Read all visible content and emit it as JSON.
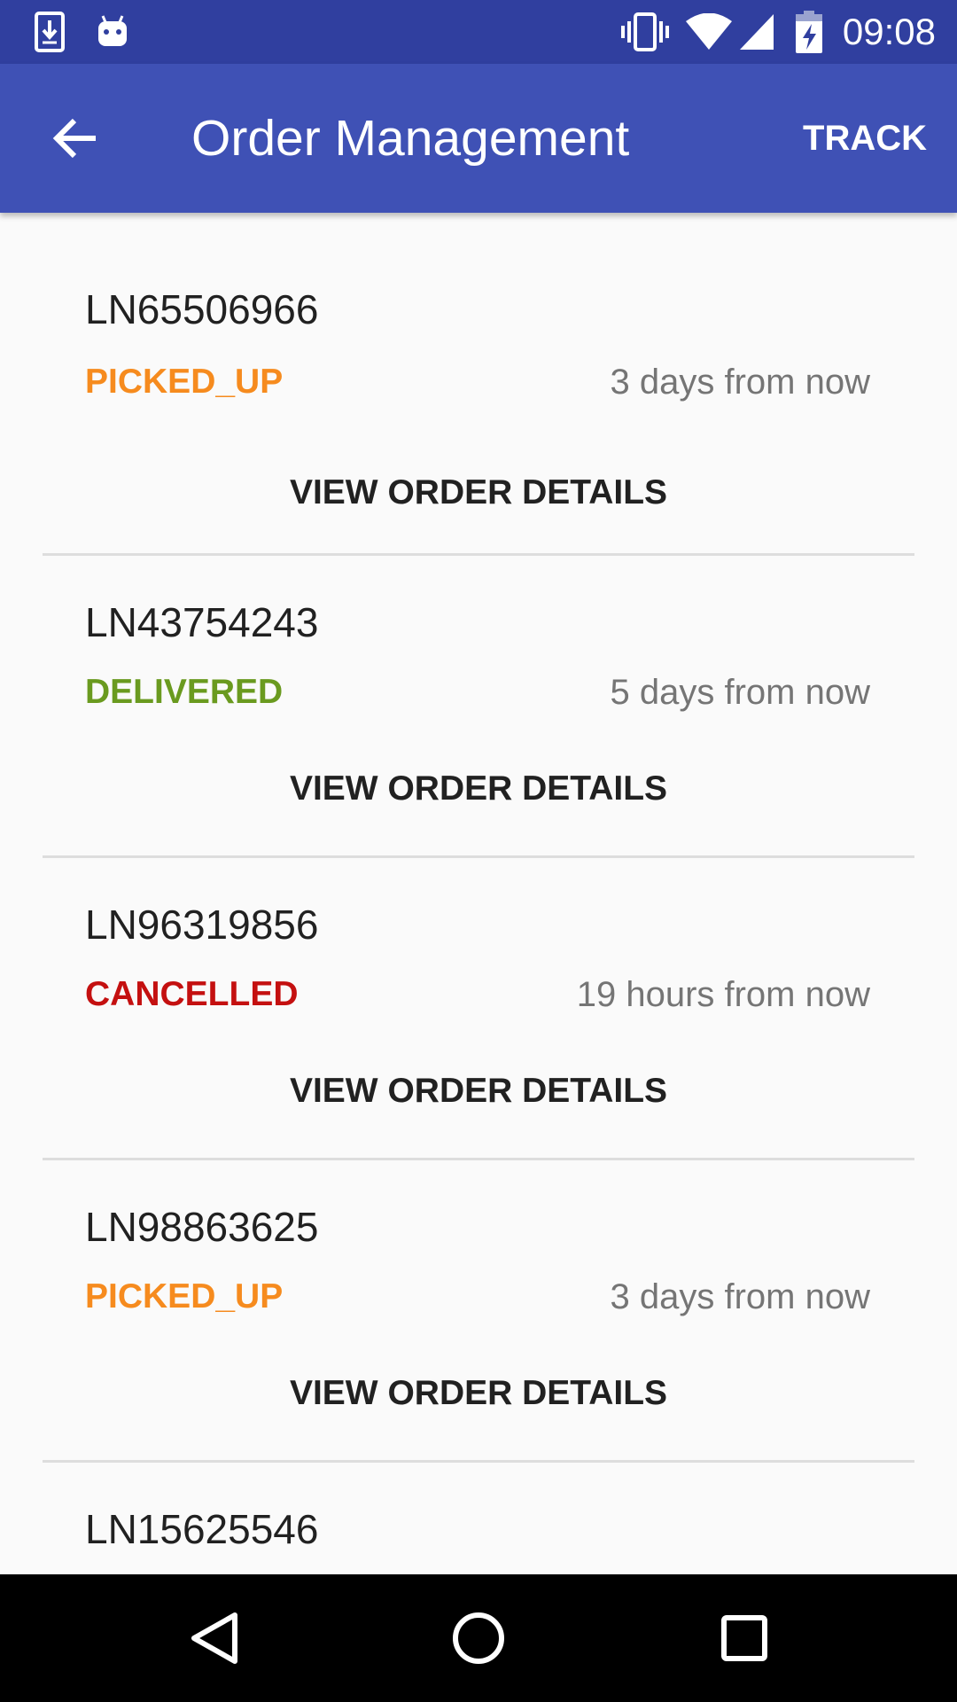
{
  "status_bar": {
    "time": "09:08",
    "background": "#303f9f",
    "left_icons": [
      "download-icon",
      "android-icon"
    ],
    "right_icons": [
      "vibrate-icon",
      "wifi-icon",
      "signal-icon",
      "battery-charging-icon"
    ]
  },
  "app_bar": {
    "title": "Order Management",
    "action_label": "TRACK",
    "background": "#3f51b5",
    "back_icon": "arrow-back-icon"
  },
  "orders": [
    {
      "id": "LN65506966",
      "status": "PICKED_UP",
      "status_color": "#f68b1e",
      "time": "3 days from now",
      "action": "VIEW ORDER DETAILS"
    },
    {
      "id": "LN43754243",
      "status": "DELIVERED",
      "status_color": "#6a9a1f",
      "time": "5 days from now",
      "action": "VIEW ORDER DETAILS"
    },
    {
      "id": "LN96319856",
      "status": "CANCELLED",
      "status_color": "#c41010",
      "time": "19 hours from now",
      "action": "VIEW ORDER DETAILS"
    },
    {
      "id": "LN98863625",
      "status": "PICKED_UP",
      "status_color": "#f68b1e",
      "time": "3 days from now",
      "action": "VIEW ORDER DETAILS"
    },
    {
      "id": "LN15625546"
    }
  ],
  "nav_bar": {
    "buttons": [
      "back-triangle-icon",
      "home-circle-icon",
      "recents-square-icon"
    ]
  }
}
